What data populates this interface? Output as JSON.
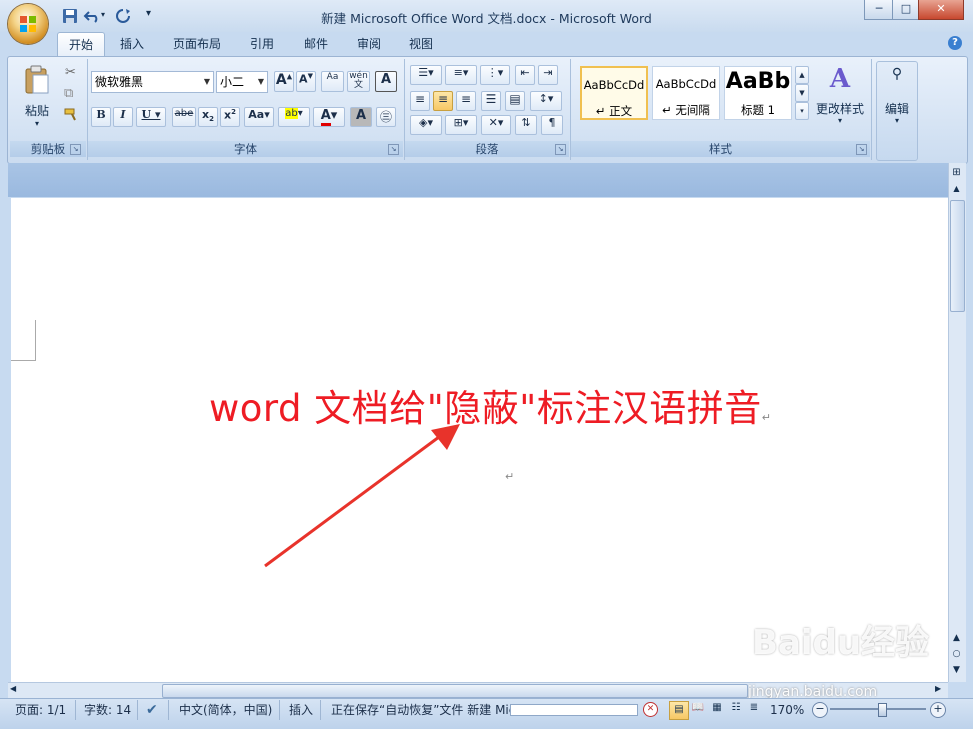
{
  "window": {
    "title": "新建 Microsoft Office Word 文档.docx - Microsoft Word",
    "minimize": "─",
    "maximize": "□",
    "close": "✕"
  },
  "tabs": [
    {
      "label": "开始",
      "active": true
    },
    {
      "label": "插入"
    },
    {
      "label": "页面布局"
    },
    {
      "label": "引用"
    },
    {
      "label": "邮件"
    },
    {
      "label": "审阅"
    },
    {
      "label": "视图"
    }
  ],
  "ribbon": {
    "clipboard": {
      "group_label": "剪贴板",
      "paste_label": "粘贴"
    },
    "font": {
      "group_label": "字体",
      "font_name": "微软雅黑",
      "font_size": "小二"
    },
    "paragraph": {
      "group_label": "段落"
    },
    "styles": {
      "group_label": "样式",
      "items": [
        {
          "sample": "AaBbCcDd",
          "name": "↵ 正文",
          "selected": true
        },
        {
          "sample": "AaBbCcDd",
          "name": "↵ 无间隔"
        },
        {
          "sample": "AaBb",
          "name": "标题 1"
        }
      ],
      "change_styles": "更改样式"
    },
    "editing": {
      "label": "编辑"
    }
  },
  "document": {
    "text": "word 文档给\"隐蔽\"标注汉语拼音",
    "text_color": "#ee1c24",
    "pilcrow": "↵"
  },
  "statusbar": {
    "page": "页面: 1/1",
    "words": "字数: 14",
    "language": "中文(简体，中国)",
    "insert_mode": "插入",
    "saving": "正在保存“自动恢复”文件 新建 Mic...",
    "zoom": "170%"
  },
  "watermark": {
    "brand": "Baidu经验",
    "url": "jingyan.baidu.com"
  },
  "colors": {
    "accent": "#c7daf0",
    "annotation_arrow": "#e8332b"
  }
}
